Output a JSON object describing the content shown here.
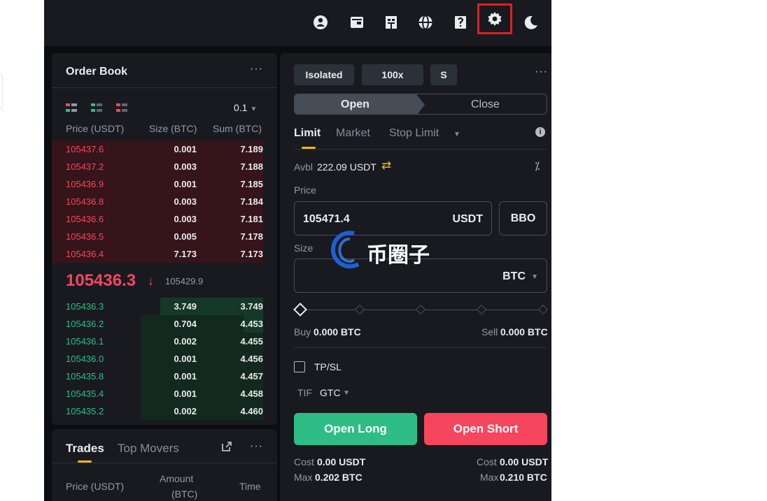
{
  "header": {
    "icons": [
      "user-icon",
      "wallet-icon",
      "orders-icon",
      "globe-icon",
      "download-qr-icon",
      "gear-icon",
      "moon-icon"
    ],
    "highlight_color": "#e02020"
  },
  "order_book": {
    "title": "Order Book",
    "more": "···",
    "step": "0.1",
    "col_price": "Price (USDT)",
    "col_size": "Size (BTC)",
    "col_sum": "Sum (BTC)",
    "asks": [
      {
        "price": "105437.6",
        "size": "0.001",
        "sum": "7.189"
      },
      {
        "price": "105437.2",
        "size": "0.003",
        "sum": "7.188"
      },
      {
        "price": "105436.9",
        "size": "0.001",
        "sum": "7.185"
      },
      {
        "price": "105436.8",
        "size": "0.003",
        "sum": "7.184"
      },
      {
        "price": "105436.6",
        "size": "0.003",
        "sum": "7.181"
      },
      {
        "price": "105436.5",
        "size": "0.005",
        "sum": "7.178"
      },
      {
        "price": "105436.4",
        "size": "7.173",
        "sum": "7.173"
      }
    ],
    "last_price": "105436.3",
    "mark_price": "105429.9",
    "bids": [
      {
        "price": "105436.3",
        "size": "3.749",
        "sum": "3.749"
      },
      {
        "price": "105436.2",
        "size": "0.704",
        "sum": "4.453"
      },
      {
        "price": "105436.1",
        "size": "0.002",
        "sum": "4.455"
      },
      {
        "price": "105436.0",
        "size": "0.001",
        "sum": "4.456"
      },
      {
        "price": "105435.8",
        "size": "0.001",
        "sum": "4.457"
      },
      {
        "price": "105435.4",
        "size": "0.001",
        "sum": "4.458"
      },
      {
        "price": "105435.2",
        "size": "0.002",
        "sum": "4.460"
      }
    ],
    "colors": {
      "ask": "#f6465d",
      "bid": "#2ebd85"
    }
  },
  "trades": {
    "tab_trades": "Trades",
    "tab_movers": "Top Movers",
    "col_price": "Price (USDT)",
    "col_amount_1": "Amount",
    "col_amount_2": "(BTC)",
    "col_time": "Time"
  },
  "form": {
    "margin_mode": "Isolated",
    "leverage": "100x",
    "asset_mode": "S",
    "tab_open": "Open",
    "tab_close": "Close",
    "order_types": [
      "Limit",
      "Market",
      "Stop Limit"
    ],
    "avbl_label": "Avbl",
    "avbl_value": "222.09 USDT",
    "price_label": "Price",
    "price_value": "105471.4",
    "price_unit": "USDT",
    "bbo": "BBO",
    "size_label": "Size",
    "size_unit": "BTC",
    "buy_label": "Buy",
    "buy_value": "0.000 BTC",
    "sell_label": "Sell",
    "sell_value": "0.000 BTC",
    "tpsl": "TP/SL",
    "tif_label": "TIF",
    "tif_value": "GTC",
    "open_long": "Open Long",
    "open_short": "Open Short",
    "cost_label": "Cost",
    "cost_long": "0.00 USDT",
    "cost_short": "0.00 USDT",
    "max_label": "Max",
    "max_long": "0.202 BTC",
    "max_short": "0.210 BTC"
  },
  "watermark": {
    "text": "币圈子"
  }
}
